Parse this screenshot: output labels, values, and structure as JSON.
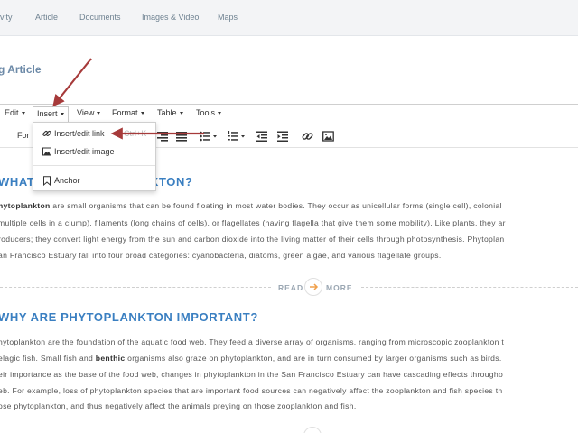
{
  "nav": {
    "items": [
      "ivity",
      "Article",
      "Documents",
      "Images & Video",
      "Maps"
    ]
  },
  "page": {
    "title": "g Article"
  },
  "menubar": {
    "items": [
      "Edit",
      "Insert",
      "View",
      "Format",
      "Table",
      "Tools"
    ],
    "active": "Insert"
  },
  "toolbar": {
    "format_label": "For"
  },
  "dropdown": {
    "items": [
      "Insert/edit link",
      "Insert/edit image",
      "Anchor"
    ],
    "link_shortcut": "Ctrl+K"
  },
  "article": {
    "heading1_left": "WHAT",
    "heading1_right": "NKTON?",
    "para1": [
      [
        "hytoplankton",
        " are small organisms that can be found floating in most water bodies. They occur as unicellular forms (single cell), colonial"
      ],
      [
        "",
        "multiple cells in a clump), filaments (long chains of cells), or flagellates (having flagella that give them some mobility). Like plants, they ar"
      ],
      [
        "",
        "roducers; they convert light energy from the sun and carbon dioxide into the living matter of their cells through photosynthesis. Phytoplan"
      ],
      [
        "",
        "an Francisco Estuary fall into four broad categories: cyanobacteria, diatoms, green algae, and various flagellate groups."
      ]
    ],
    "read": "READ",
    "more": "MORE",
    "heading2": "WHY ARE PHYTOPLANKTON IMPORTANT?",
    "para2": [
      "hytoplankton are the foundation of the aquatic food web. They feed a diverse array of organisms, ranging from microscopic zooplankton t",
      "elagic fish. Small fish and ",
      "benthic",
      " organisms also graze on phytoplankton, and are in turn consumed by larger organisms such as birds.",
      "eir importance as the base of the food web, changes in phytoplankton in the San Francisco Estuary can have cascading effects througho",
      "eb. For example, loss of phytoplankton species that are important food sources can negatively affect the zooplankton and fish species th",
      "ose phytoplankton, and thus negatively affect the animals preying on those zooplankton and fish."
    ]
  },
  "colors": {
    "accent": "#3a7fc1",
    "arrow": "#a63a3a",
    "readmore_icon": "#f0a04b"
  }
}
